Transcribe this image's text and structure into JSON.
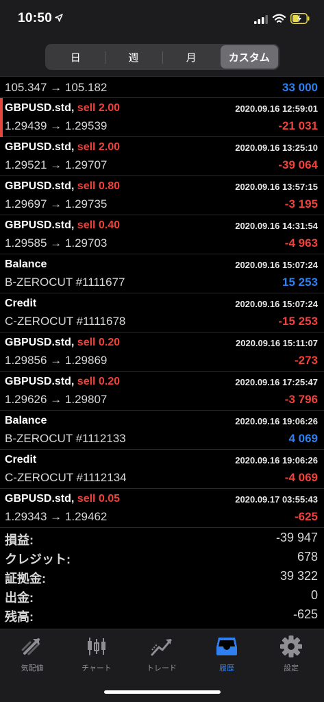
{
  "status": {
    "time": "10:50"
  },
  "tabs_top": {
    "day": "日",
    "week": "週",
    "month": "月",
    "custom": "カスタム"
  },
  "first_row": {
    "prices": "105.347 → 105.182",
    "profit": "33 000"
  },
  "rows": [
    {
      "symbol": "GBPUSD.std,",
      "action": "sell 2.00",
      "time": "2020.09.16 12:59:01",
      "detail": "1.29439 → 1.29539",
      "profit": "-21 031"
    },
    {
      "symbol": "GBPUSD.std,",
      "action": "sell 2.00",
      "time": "2020.09.16 13:25:10",
      "detail": "1.29521 → 1.29707",
      "profit": "-39 064"
    },
    {
      "symbol": "GBPUSD.std,",
      "action": "sell 0.80",
      "time": "2020.09.16 13:57:15",
      "detail": "1.29697 → 1.29735",
      "profit": "-3 195"
    },
    {
      "symbol": "GBPUSD.std,",
      "action": "sell 0.40",
      "time": "2020.09.16 14:31:54",
      "detail": "1.29585 → 1.29703",
      "profit": "-4 963"
    },
    {
      "symbol": "Balance",
      "action": "",
      "time": "2020.09.16 15:07:24",
      "detail": "B-ZEROCUT #1111677",
      "profit": "15 253"
    },
    {
      "symbol": "Credit",
      "action": "",
      "time": "2020.09.16 15:07:24",
      "detail": "C-ZEROCUT #1111678",
      "profit": "-15 253"
    },
    {
      "symbol": "GBPUSD.std,",
      "action": "sell 0.20",
      "time": "2020.09.16 15:11:07",
      "detail": "1.29856 → 1.29869",
      "profit": "-273"
    },
    {
      "symbol": "GBPUSD.std,",
      "action": "sell 0.20",
      "time": "2020.09.16 17:25:47",
      "detail": "1.29626 → 1.29807",
      "profit": "-3 796"
    },
    {
      "symbol": "Balance",
      "action": "",
      "time": "2020.09.16 19:06:26",
      "detail": "B-ZEROCUT #1112133",
      "profit": "4 069"
    },
    {
      "symbol": "Credit",
      "action": "",
      "time": "2020.09.16 19:06:26",
      "detail": "C-ZEROCUT #1112134",
      "profit": "-4 069"
    },
    {
      "symbol": "GBPUSD.std,",
      "action": "sell 0.05",
      "time": "2020.09.17 03:55:43",
      "detail": "1.29343 → 1.29462",
      "profit": "-625"
    }
  ],
  "summary": {
    "pl_label": "損益:",
    "pl_value": "-39 947",
    "credit_label": "クレジット:",
    "credit_value": "678",
    "deposit_label": "証拠金:",
    "deposit_value": "39 322",
    "withdrawal_label": "出金:",
    "withdrawal_value": "0",
    "balance_label": "残高:",
    "balance_value": "-625"
  },
  "tabbar": {
    "quotes": "気配値",
    "chart": "チャート",
    "trade": "トレード",
    "history": "履歴",
    "settings": "設定"
  },
  "colors": {
    "negative": "#f0413b",
    "positive": "#2f7ff0",
    "active_tab": "#2f7ff0"
  }
}
